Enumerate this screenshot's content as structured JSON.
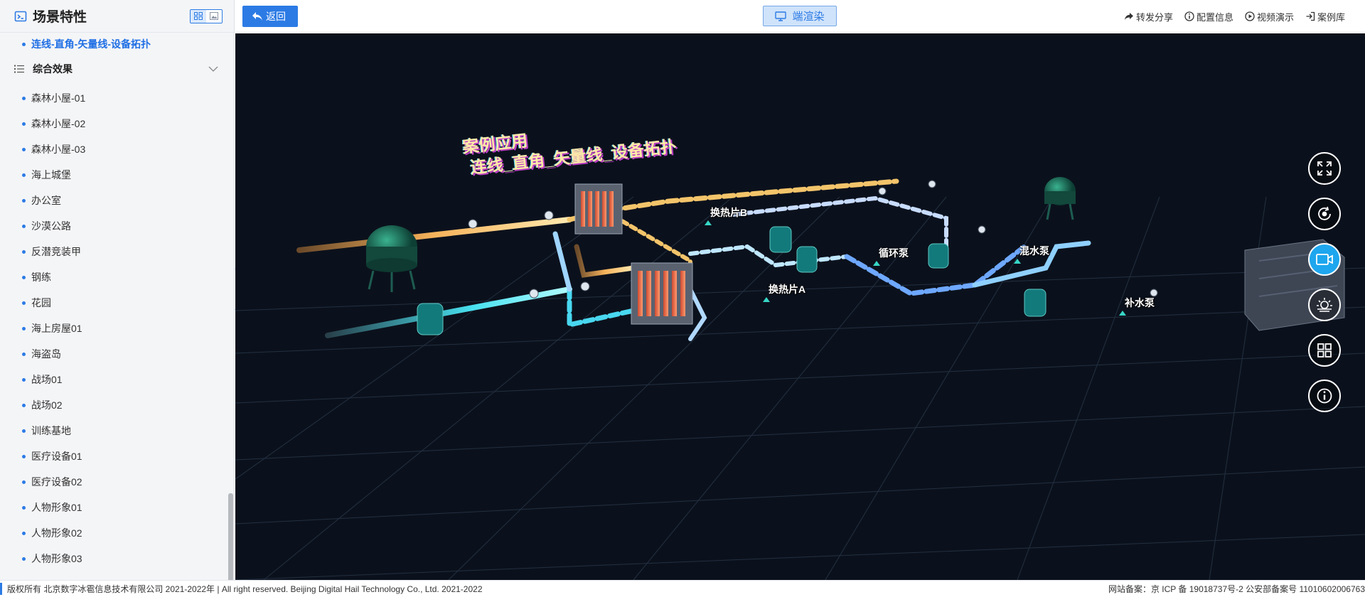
{
  "sidebar": {
    "title": "场景特性",
    "active_item": "连线-直角-矢量线-设备拓扑",
    "group_label": "综合效果",
    "items": [
      "森林小屋-01",
      "森林小屋-02",
      "森林小屋-03",
      "海上城堡",
      "办公室",
      "沙漠公路",
      "反潜竞装甲",
      "钢练",
      "花园",
      "海上房屋01",
      "海盗岛",
      "战场01",
      "战场02",
      "训练基地",
      "医疗设备01",
      "医疗设备02",
      "人物形象01",
      "人物形象02",
      "人物形象03"
    ]
  },
  "topbar": {
    "back_label": "返回",
    "render_label": "端渲染",
    "links": [
      "转发分享",
      "配置信息",
      "视频演示",
      "案例库"
    ]
  },
  "scene": {
    "title_line1": "案例应用",
    "title_line2": "连线_直角_矢量线_设备拓扑",
    "labels": [
      "换热片B",
      "换热片A",
      "循环泵",
      "混水泵",
      "补水泵"
    ]
  },
  "controls": [
    "fullscreen-icon",
    "rotate-icon",
    "camera-icon",
    "weather-icon",
    "grid-icon",
    "info-icon"
  ],
  "footer": {
    "copyright": "版权所有 北京数字冰雹信息技术有限公司 2021-2022年 | All right reserved. Beijing Digital Hail Technology Co., Ltd. 2021-2022",
    "icp": "网站备案：京 ICP 备 19018737号-2 公安部备案号 11010602006763"
  },
  "colors": {
    "accent": "#2c7be5",
    "viewport_bg": "#0b111c",
    "active_control": "#1ea6ee"
  }
}
